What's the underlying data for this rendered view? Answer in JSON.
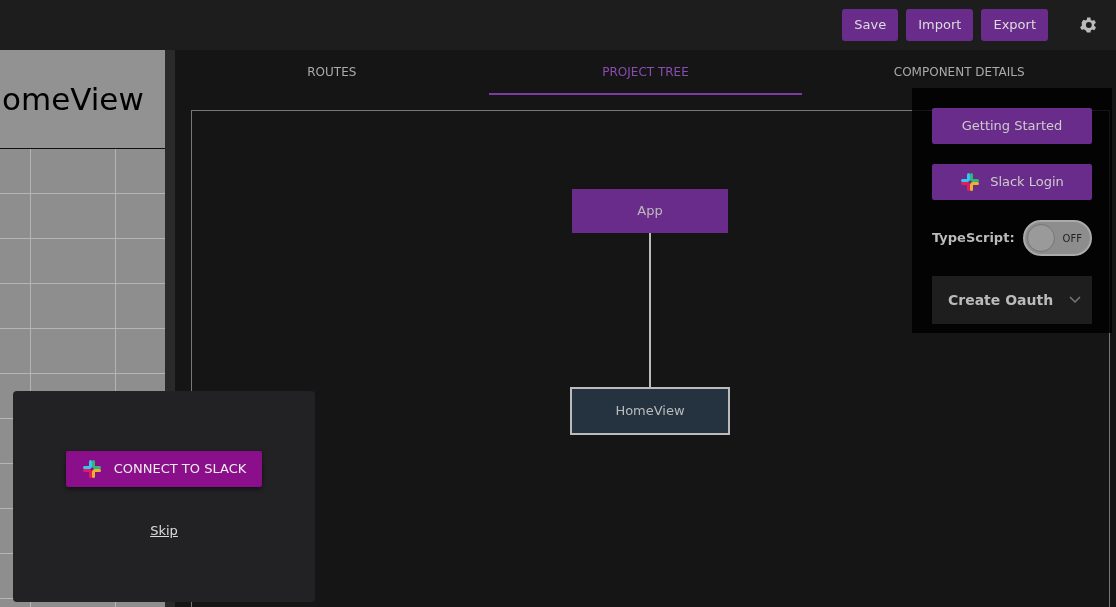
{
  "toolbar": {
    "buttons": [
      "Save",
      "Import",
      "Export"
    ]
  },
  "preview": {
    "heading": "omeView"
  },
  "tabs": [
    {
      "label": "ROUTES",
      "selected": false
    },
    {
      "label": "PROJECT TREE",
      "selected": true
    },
    {
      "label": "COMPONENT DETAILS",
      "selected": false
    }
  ],
  "tree": {
    "label": "App",
    "selected": false,
    "children": [
      {
        "label": "HomeView",
        "selected": true
      }
    ]
  },
  "settings_menu": {
    "buttons": [
      {
        "label": "Getting Started",
        "kind": "plain"
      },
      {
        "label": "Slack Login",
        "kind": "slack"
      }
    ],
    "toggle": {
      "label": "TypeScript:",
      "on": false,
      "state_text": "OFF"
    },
    "accordion": {
      "label": "Create Oauth",
      "expanded": false
    }
  },
  "slack_dialog": {
    "button": "CONNECT TO SLACK",
    "link": "Skip"
  }
}
